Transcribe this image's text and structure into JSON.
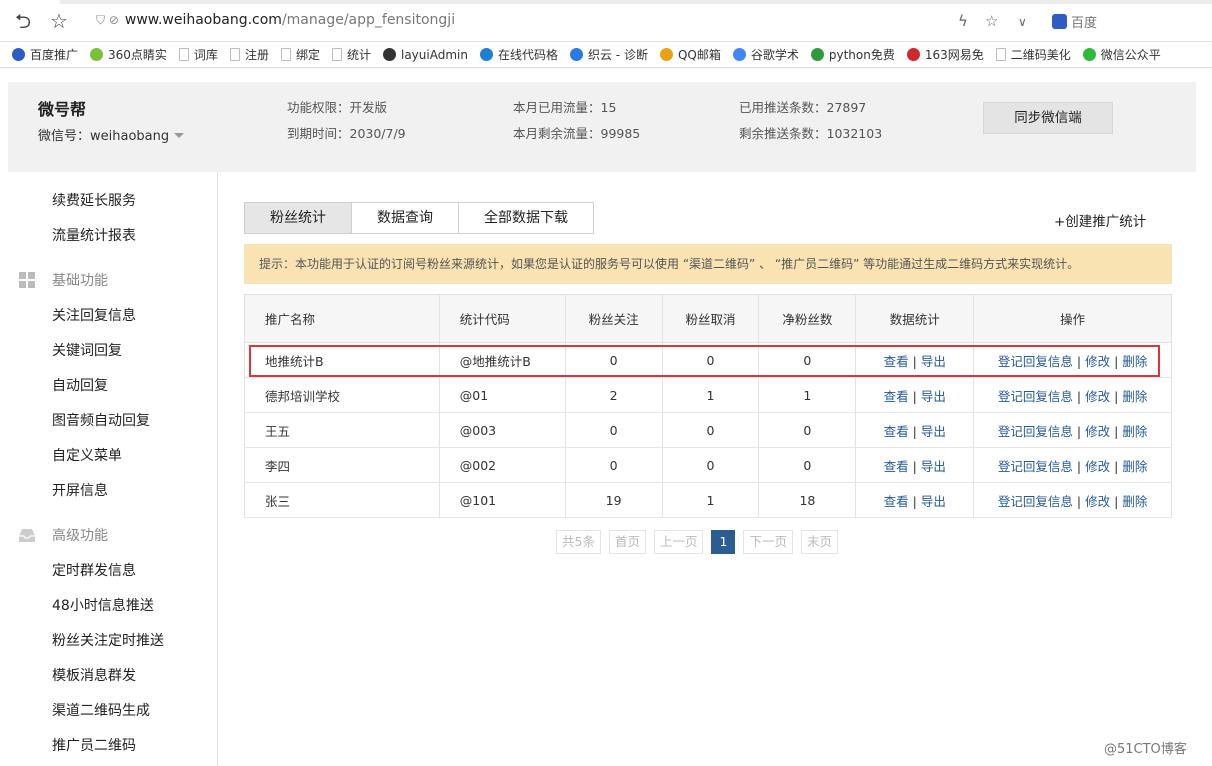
{
  "browser": {
    "url_main": "www.weihaobang.com",
    "url_path": "/manage/app_fensitongji",
    "search_engine": "百度"
  },
  "bookmarks": [
    {
      "label": "百度推广",
      "icon": "baidu-paw-icon",
      "color": "#2e5bc4"
    },
    {
      "label": "360点睛实",
      "icon": "360-icon",
      "color": "#7cc13a"
    },
    {
      "label": "词库",
      "icon": "page-icon",
      "color": "#bbbbbb"
    },
    {
      "label": "注册",
      "icon": "page-icon",
      "color": "#bbbbbb"
    },
    {
      "label": "绑定",
      "icon": "page-icon",
      "color": "#bbbbbb"
    },
    {
      "label": "统计",
      "icon": "page-icon",
      "color": "#bbbbbb"
    },
    {
      "label": "layuiAdmin",
      "icon": "layui-icon",
      "color": "#333333"
    },
    {
      "label": "在线代码格",
      "icon": "code-icon",
      "color": "#1f7fd0"
    },
    {
      "label": "织云 - 诊断",
      "icon": "zhiyun-icon",
      "color": "#2a7be0"
    },
    {
      "label": "QQ邮箱",
      "icon": "qqmail-icon",
      "color": "#e8a21a"
    },
    {
      "label": "谷歌学术",
      "icon": "google-icon",
      "color": "#4285f4"
    },
    {
      "label": "python免费",
      "icon": "96-icon",
      "color": "#2f9a3a"
    },
    {
      "label": "163网易免",
      "icon": "163-icon",
      "color": "#d0282e"
    },
    {
      "label": "二维码美化",
      "icon": "page-icon",
      "color": "#bbbbbb"
    },
    {
      "label": "微信公众平",
      "icon": "wechat-icon",
      "color": "#2dbb3a"
    }
  ],
  "header": {
    "brand": "微号帮",
    "wechat_id": "微信号：weihaobang",
    "permission": "功能权限：开发版",
    "expire": "到期时间：2030/7/9",
    "used_traffic": "本月已用流量：15",
    "remaining_traffic": "本月剩余流量：99985",
    "used_push": "已用推送条数：27897",
    "remaining_push": "剩余推送条数：1032103",
    "sync_button": "同步微信端"
  },
  "sidebar": {
    "top_items": [
      "续费延长服务",
      "流量统计报表"
    ],
    "basic_group": "基础功能",
    "basic_items": [
      "关注回复信息",
      "关键词回复",
      "自动回复",
      "图音频自动回复",
      "自定义菜单",
      "开屏信息"
    ],
    "advanced_group": "高级功能",
    "advanced_items": [
      "定时群发信息",
      "48小时信息推送",
      "粉丝关注定时推送",
      "模板消息群发",
      "渠道二维码生成",
      "推广员二维码"
    ]
  },
  "tabs": [
    "粉丝统计",
    "数据查询",
    "全部数据下载"
  ],
  "create_link": "+创建推广统计",
  "tip": "提示：本功能用于认证的订阅号粉丝来源统计，如果您是认证的服务号可以使用 “渠道二维码” 、 “推广员二维码” 等功能通过生成二维码方式来实现统计。",
  "table": {
    "headers": [
      "推广名称",
      "统计代码",
      "粉丝关注",
      "粉丝取消",
      "净粉丝数",
      "数据统计",
      "操作"
    ],
    "rows": [
      {
        "name": "地推统计B",
        "code": "@地推统计B",
        "follow": "0",
        "cancel": "0",
        "net": "0"
      },
      {
        "name": "德邦培训学校",
        "code": "@01",
        "follow": "2",
        "cancel": "1",
        "net": "1"
      },
      {
        "name": "王五",
        "code": "@003",
        "follow": "0",
        "cancel": "0",
        "net": "0"
      },
      {
        "name": "李四",
        "code": "@002",
        "follow": "0",
        "cancel": "0",
        "net": "0"
      },
      {
        "name": "张三",
        "code": "@101",
        "follow": "19",
        "cancel": "1",
        "net": "18"
      }
    ],
    "link_view": "查看",
    "link_export": "导出",
    "link_register": "登记回复信息",
    "link_edit": "修改",
    "link_delete": "删除",
    "separator": "|"
  },
  "pager": {
    "total": "共5条",
    "first": "首页",
    "prev": "上一页",
    "current": "1",
    "next": "下一页",
    "last": "末页"
  },
  "watermark": "@51CTO博客",
  "colors": {
    "highlight": "#d9363e",
    "tip_bg": "#f9e3b2",
    "link": "#245a9a",
    "page_current": "#2b5d93"
  }
}
